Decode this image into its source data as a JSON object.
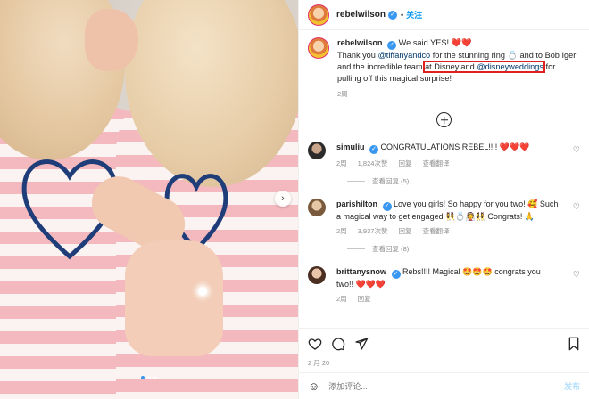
{
  "post": {
    "username": "rebelwilson",
    "follow_label": "关注",
    "separator": "•",
    "caption_lead": "We said YES!",
    "caption_lead_hearts": "❤️❤️",
    "caption_p1": "Thank you ",
    "caption_mention1": "@tiffanyandco",
    "caption_p2": " for the stunning ring 💍 and to Bob Iger and the incredible team ",
    "caption_highlight_plain": "at Disneyland ",
    "caption_mention2": "@disneyweddings",
    "caption_p3": " for pulling off this magical surprise!",
    "caption_time": "2周",
    "date": "2 月 20"
  },
  "comments": [
    {
      "username": "simuliu",
      "text": "CONGRATULATIONS REBEL!!!! ❤️❤️❤️",
      "time": "2周",
      "likes": "1,824次赞",
      "reply": "回复",
      "translate": "查看翻译",
      "replies": "查看回复 (5)"
    },
    {
      "username": "parishilton",
      "text": "Love you girls! So happy for you two! 🥰 Such a magical way to get engaged 👯‍♀️💍👰👯‍♀️ Congrats! 🙏",
      "time": "2周",
      "likes": "3,937次赞",
      "reply": "回复",
      "translate": "查看翻译",
      "replies": "查看回复 (8)"
    },
    {
      "username": "brittanysnow",
      "text": "Rebs!!!! Magical 🤩🤩🤩 congrats you two!! ❤️❤️❤️",
      "time": "2周",
      "likes": "",
      "reply": "回复",
      "translate": "",
      "replies": ""
    }
  ],
  "compose": {
    "placeholder": "添加评论...",
    "post_label": "发布"
  },
  "icons": {
    "like": "heart-icon",
    "comment": "comment-icon",
    "share": "send-icon",
    "save": "bookmark-icon",
    "add": "add-circle-icon",
    "emoji": "smiley-icon",
    "verified": "verified-badge-icon"
  },
  "colors": {
    "accent": "#0095f6",
    "highlight_box": "#e01f1f",
    "verified": "#3897f0",
    "stripe_pink": "#f4b9bf"
  }
}
